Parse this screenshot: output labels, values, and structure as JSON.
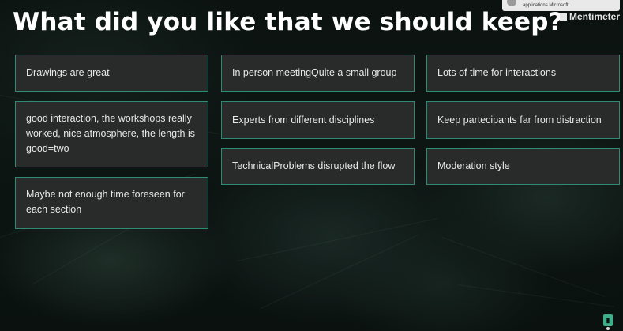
{
  "slide": {
    "title": "What did you like that we should keep?",
    "brand": "Mentimeter"
  },
  "notification": {
    "text": "applications Microsoft."
  },
  "responses": [
    "Drawings are great",
    "In person meetingQuite a small group",
    "Lots of time for interactions",
    "good interaction, the workshops really worked, nice atmosphere, the length is good=two",
    "Experts from different disciplines",
    "Keep partecipants far from distraction",
    "TechnicalProblems disrupted the flow",
    "Moderation style",
    "Maybe not enough time foreseen for each section"
  ],
  "colors": {
    "card_border": "#2f8a76",
    "card_background": "#292b2a",
    "title_text": "#ffffff"
  },
  "icons": {
    "bottom_right": "presenter-badge-icon"
  }
}
